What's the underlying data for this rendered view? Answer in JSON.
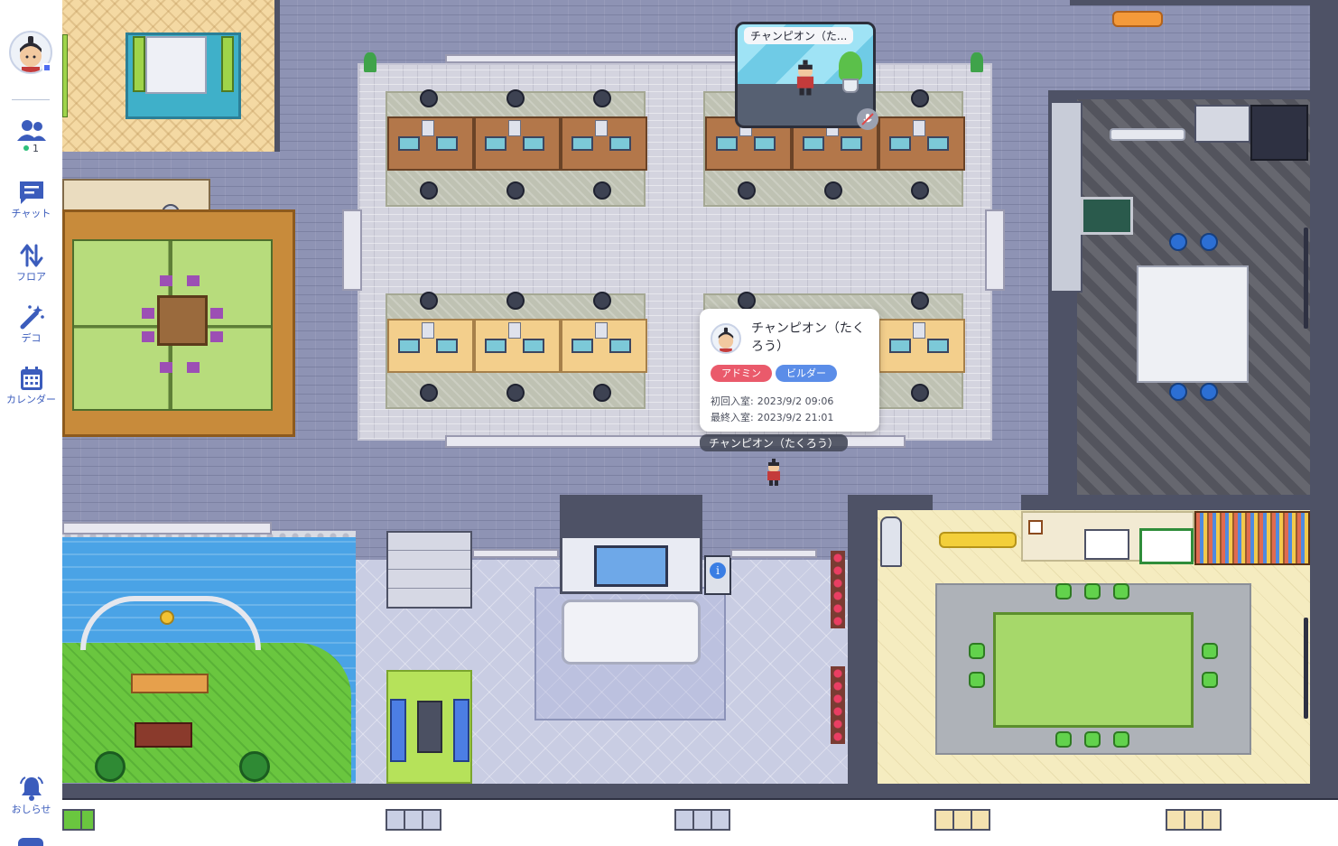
{
  "sidebar": {
    "members_label": "",
    "online_count": "1",
    "items": [
      {
        "label": "チャット",
        "icon": "chat-icon"
      },
      {
        "label": "フロア",
        "icon": "floor-switch-icon"
      },
      {
        "label": "デコ",
        "icon": "magic-wand-icon"
      },
      {
        "label": "カレンダー",
        "icon": "calendar-icon"
      }
    ],
    "notifications_label": "おしらせ"
  },
  "video_tile": {
    "name": "チャンピオン（た..."
  },
  "profile_card": {
    "name": "チャンピオン（たくろう）",
    "tags": [
      "アドミン",
      "ビルダー"
    ],
    "first_entry_label": "初回入室:",
    "first_entry_value": "2023/9/2 09:06",
    "last_entry_label": "最終入室:",
    "last_entry_value": "2023/9/2 21:01"
  },
  "avatar_label": "チャンピオン（たくろう）",
  "colors": {
    "sidebar_accent": "#3b5cbc",
    "admin_tag": "#ea5a6b",
    "builder_tag": "#5b8de8",
    "online_dot": "#2ebf7a"
  }
}
